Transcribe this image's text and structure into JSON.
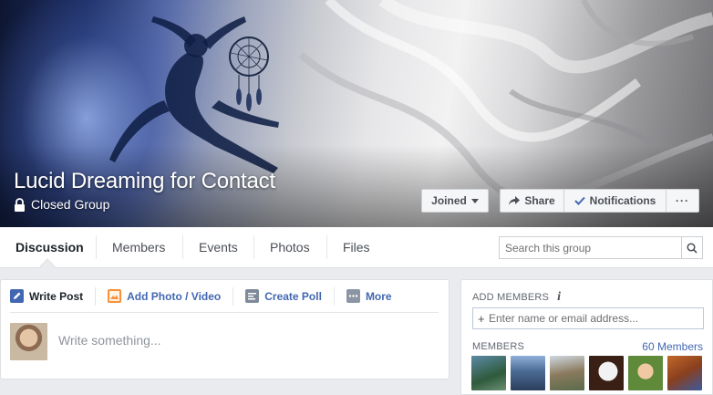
{
  "cover": {
    "group_name": "Lucid Dreaming for Contact",
    "privacy_label": "Closed Group",
    "buttons": {
      "joined": "Joined",
      "share": "Share",
      "notifications": "Notifications",
      "more": "···"
    }
  },
  "tabs": [
    {
      "label": "Discussion",
      "active": true
    },
    {
      "label": "Members"
    },
    {
      "label": "Events"
    },
    {
      "label": "Photos"
    },
    {
      "label": "Files"
    }
  ],
  "search": {
    "placeholder": "Search this group",
    "value": ""
  },
  "composer": {
    "actions": [
      {
        "label": "Write Post",
        "icon": "pencil-icon",
        "color": "#4267b2"
      },
      {
        "label": "Add Photo / Video",
        "icon": "photo-icon",
        "color": "#f7923b"
      },
      {
        "label": "Create Poll",
        "icon": "poll-icon",
        "color": "#7f8a99"
      },
      {
        "label": "More",
        "icon": "more-dots-icon",
        "color": "#8b95a3"
      }
    ],
    "placeholder": "Write something..."
  },
  "sidebar": {
    "add_members_heading": "ADD MEMBERS",
    "add_members_placeholder": "Enter name or email address...",
    "members_heading": "MEMBERS",
    "members_count": "60 Members"
  },
  "colors": {
    "link_blue": "#4267b2",
    "page_bg": "#e9ebee"
  }
}
